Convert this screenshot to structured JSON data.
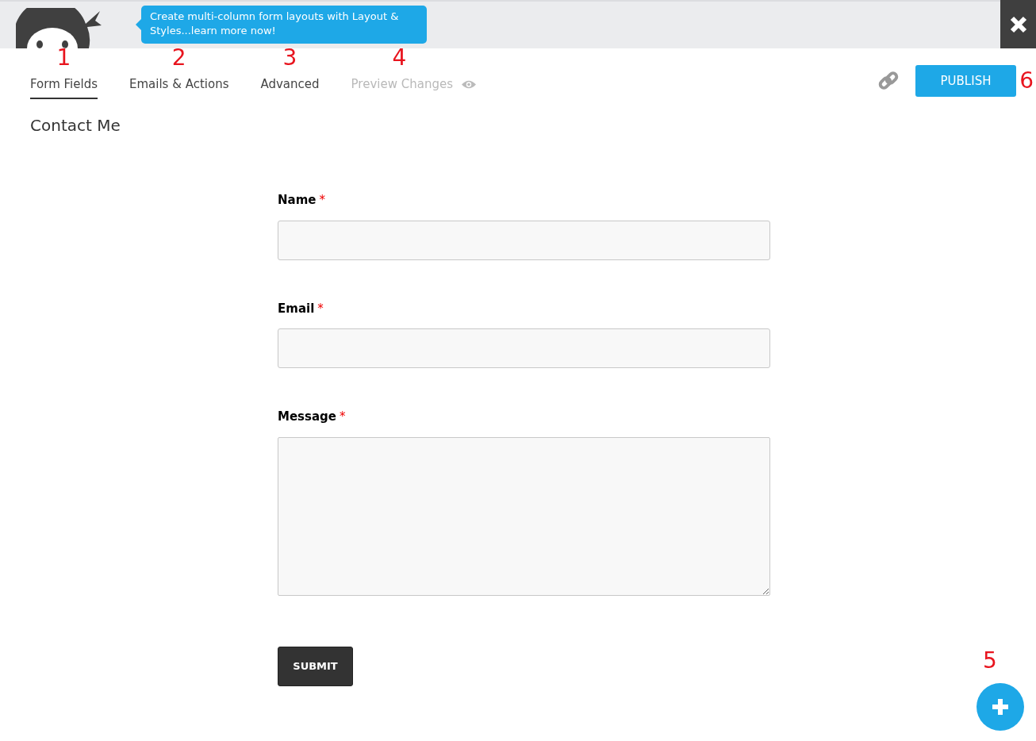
{
  "banner": {
    "tooltip": "Create multi-column form layouts with Layout & Styles...learn more now!"
  },
  "tabs": [
    {
      "label": "Form Fields",
      "selected": true,
      "disabled": false,
      "marker": "1"
    },
    {
      "label": "Emails & Actions",
      "selected": false,
      "disabled": false,
      "marker": "2"
    },
    {
      "label": "Advanced",
      "selected": false,
      "disabled": false,
      "marker": "3"
    },
    {
      "label": "Preview Changes",
      "selected": false,
      "disabled": true,
      "marker": "4"
    }
  ],
  "publish": {
    "label": "PUBLISH",
    "marker": "6"
  },
  "form": {
    "title": "Contact Me",
    "fields": [
      {
        "kind": "text",
        "label": "Name",
        "required_mark": "*"
      },
      {
        "kind": "text",
        "label": "Email",
        "required_mark": "*"
      },
      {
        "kind": "textarea",
        "label": "Message",
        "required_mark": "*"
      }
    ],
    "submit": "SUBMIT"
  },
  "add_button": {
    "marker": "5"
  }
}
